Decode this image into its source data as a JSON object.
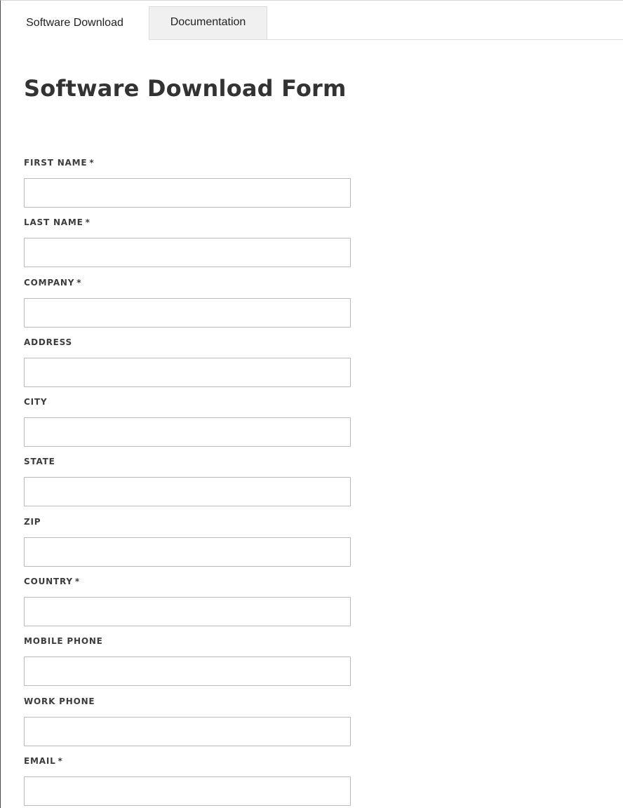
{
  "tabs": [
    {
      "label": "Software Download"
    },
    {
      "label": "Documentation"
    }
  ],
  "page_title": "Software Download Form",
  "form": {
    "fields": [
      {
        "label": "FIRST NAME",
        "required_mark": "*",
        "value": ""
      },
      {
        "label": "LAST NAME",
        "required_mark": "*",
        "value": ""
      },
      {
        "label": "COMPANY",
        "required_mark": "*",
        "value": ""
      },
      {
        "label": "ADDRESS",
        "required_mark": "",
        "value": ""
      },
      {
        "label": "CITY",
        "required_mark": "",
        "value": ""
      },
      {
        "label": "STATE",
        "required_mark": "",
        "value": ""
      },
      {
        "label": "ZIP",
        "required_mark": "",
        "value": ""
      },
      {
        "label": "COUNTRY",
        "required_mark": "*",
        "value": ""
      },
      {
        "label": "MOBILE PHONE",
        "required_mark": "",
        "value": ""
      },
      {
        "label": "WORK PHONE",
        "required_mark": "",
        "value": ""
      },
      {
        "label": "EMAIL",
        "required_mark": "*",
        "value": ""
      }
    ]
  },
  "colors": {
    "heading": "#333333",
    "label": "#3c3c3c",
    "input_border": "#b9b9b9",
    "inactive_tab_bg": "#f0f0f0"
  }
}
